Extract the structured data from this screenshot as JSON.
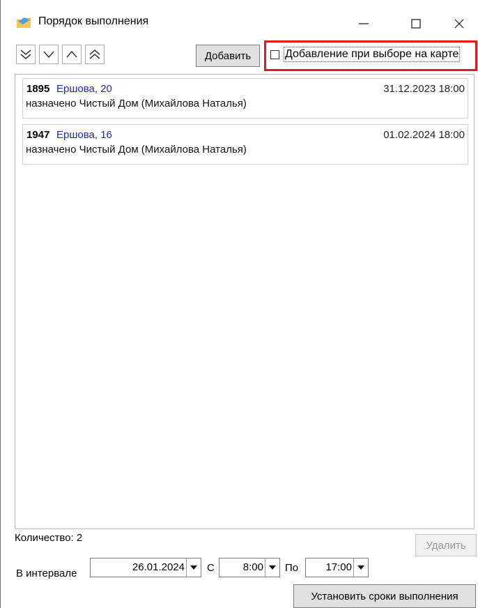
{
  "window": {
    "title": "Порядок выполнения",
    "controls": {
      "minimize": "—",
      "maximize": "☐",
      "close": "✕"
    },
    "icon": "folder-app-icon"
  },
  "toolbar": {
    "nav_buttons": [
      "move-to-bottom-icon",
      "move-down-icon",
      "move-up-icon",
      "move-to-top-icon"
    ],
    "add_label": "Добавить",
    "checkbox_label": "Добавление при выборе на карте",
    "checkbox_checked": false,
    "highlight_color": "#e31a1a"
  },
  "items": [
    {
      "number": "1895",
      "address": "Ершова, 20",
      "date": "31.12.2023 18:00",
      "description": "назначено Чистый Дом (Михайлова Наталья)"
    },
    {
      "number": "1947",
      "address": "Ершова, 16",
      "date": "01.02.2024 18:00",
      "description": "назначено Чистый Дом (Михайлова Наталья)"
    }
  ],
  "footer": {
    "count_text": "Количество: 2",
    "delete_label": "Удалить",
    "interval_label": "В интервале",
    "date_value": "26.01.2024",
    "from_label": "С",
    "from_value": "8:00",
    "to_label": "По",
    "to_value": "17:00",
    "set_deadline_label": "Установить сроки выполнения"
  },
  "colors": {
    "address_link": "#1a2fa0",
    "highlight": "#e31a1a"
  }
}
